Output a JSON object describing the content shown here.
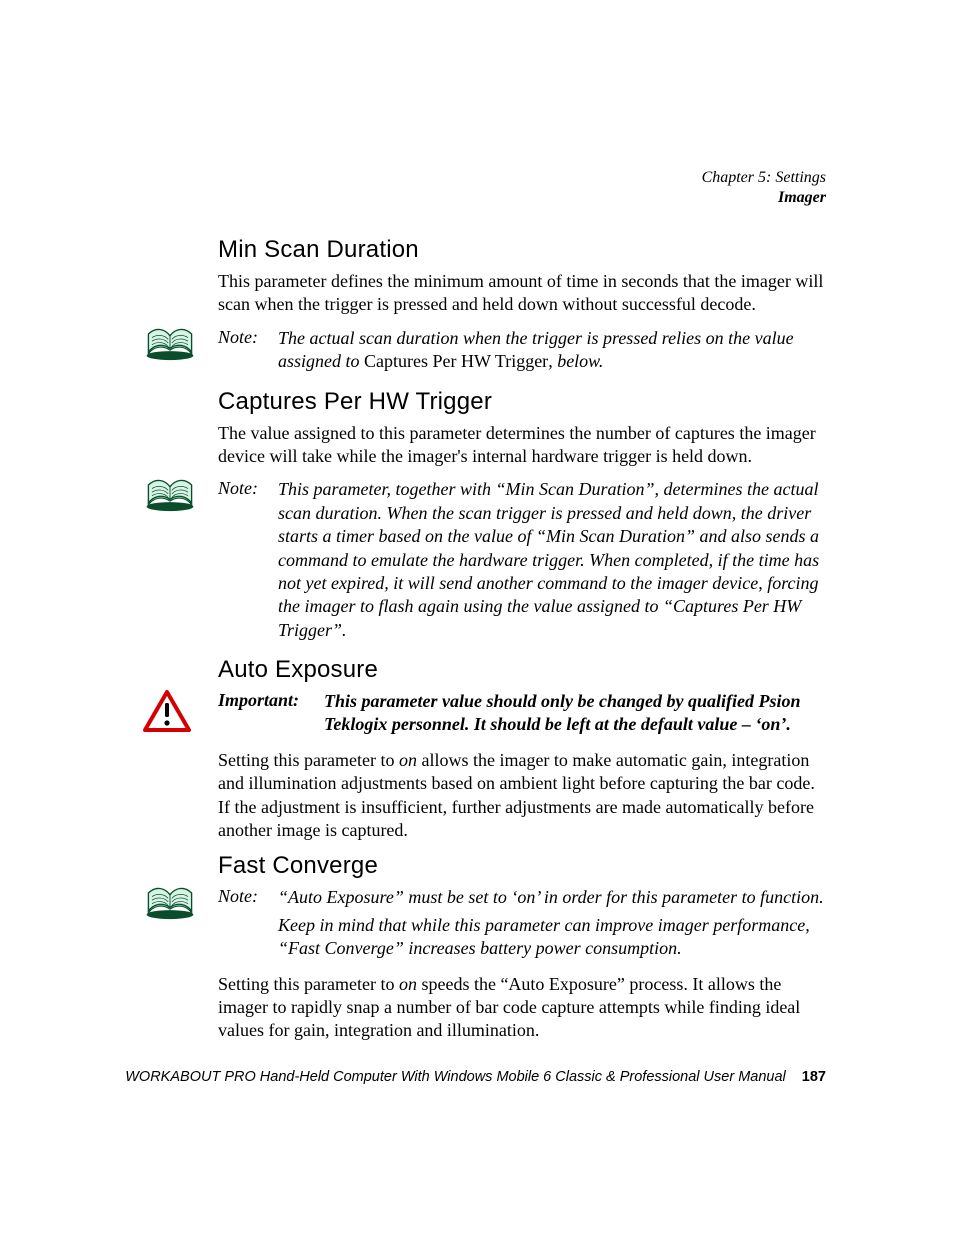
{
  "header": {
    "chapter": "Chapter 5: Settings",
    "section": "Imager"
  },
  "sections": {
    "minScan": {
      "title": "Min Scan Duration",
      "body": "This parameter defines the minimum amount of time in seconds that the imager will scan when the trigger is pressed and held down without successful decode.",
      "noteLabel": "Note:",
      "notePre": "The actual scan duration when the trigger is pressed relies on the value assigned to ",
      "noteMid": "Captures Per HW Trigger",
      "notePost": ", below."
    },
    "captures": {
      "title": "Captures Per HW Trigger",
      "body": "The value assigned to this parameter determines the number of captures the imager device will take while the imager's internal hardware trigger is held down.",
      "noteLabel": "Note:",
      "noteText": "This parameter, together with “Min Scan Duration”, determines the actual scan duration. When the scan trigger is pressed and held down, the driver starts a timer based on the value of “Min Scan Duration” and also sends a command to emulate the hardware trigger. When completed, if the time has not yet expired, it will send another command to the imager device, forcing the imager to flash again using the value assigned to “Captures Per HW Trigger”."
    },
    "autoExposure": {
      "title": "Auto Exposure",
      "impLabel": "Important:",
      "impText": "This parameter value should only be changed by qualified Psion Teklogix personnel. It should be left at the default value – ‘on’.",
      "bodyPre": "Setting this parameter to ",
      "bodyEm": "on",
      "bodyPost": " allows the imager to make automatic gain, integration and illumination adjustments based on ambient light before capturing the bar code. If the adjustment is insufficient, further adjustments are made automatically before another image is captured."
    },
    "fastConverge": {
      "title": "Fast Converge",
      "noteLabel": "Note:",
      "noteLine1": "“Auto Exposure” must be set to ‘on’ in order for this parameter to function.",
      "noteLine2": "Keep in mind that while this parameter can improve imager performance, “Fast Converge” increases battery power consumption.",
      "bodyPre": "Setting this parameter to ",
      "bodyEm": "on",
      "bodyPost": " speeds the “Auto Exposure” process. It allows the imager to rapidly snap a number of bar code capture attempts while finding ideal values for gain, integration and illumination."
    }
  },
  "footer": {
    "text": "WORKABOUT PRO Hand-Held Computer With Windows Mobile 6 Classic & Professional User Manual",
    "page": "187"
  }
}
